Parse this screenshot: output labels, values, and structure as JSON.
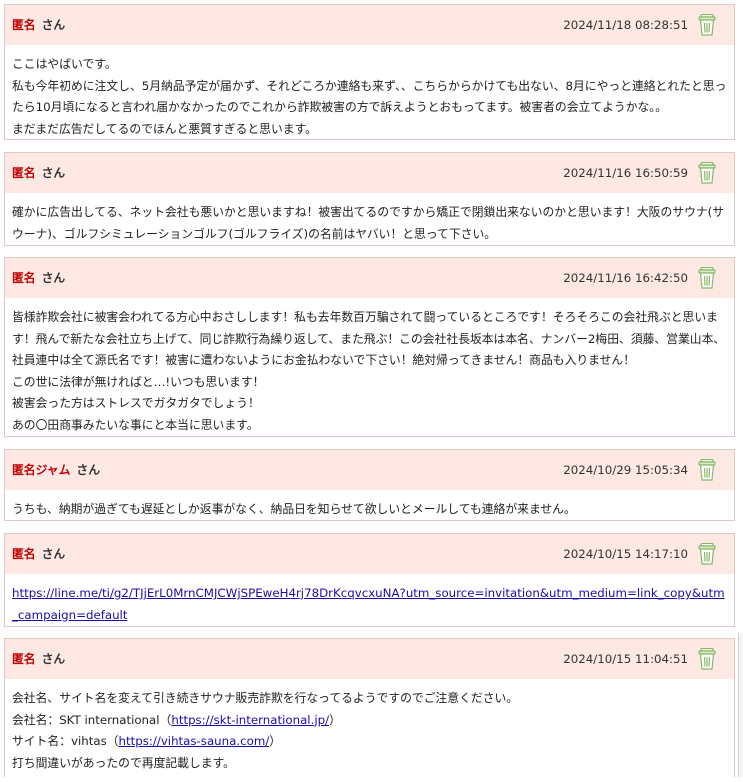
{
  "comments": [
    {
      "author": "匿名",
      "suffix": "さん",
      "date": "2024/11/18 08:28:51",
      "lines": [
        "ここはやばいです。",
        "私も今年初めに注文し、5月納品予定が届かず、それどころか連絡も来ず、、こちらからかけても出ない、8月にやっと連絡とれたと思ったら10月頃になると言われ届かなかったのでこれから詐欺被害の方で訴えようとおもってます。被害者の会立てようかな。。",
        "まだまだ広告だしてるのでほんと悪質すぎると思います。"
      ]
    },
    {
      "author": "匿名",
      "suffix": "さん",
      "date": "2024/11/16 16:50:59",
      "lines": [
        "確かに広告出してる、ネット会社も悪いかと思いますね！被害出てるのですから矯正で閉鎖出来ないのかと思います！大阪のサウナ(サウーナ)、ゴルフシミュレーションゴルフ(ゴルフライズ)の名前はヤバい！と思って下さい。"
      ]
    },
    {
      "author": "匿名",
      "suffix": "さん",
      "date": "2024/11/16 16:42:50",
      "lines": [
        "皆様詐欺会社に被害会われてる方心中おさしします！私も去年数百万騙されて闘っているところです！そろそろこの会社飛ぶと思います！飛んで新たな会社立ち上げて、同じ詐欺行為繰り返して、また飛ぶ！この会社社長坂本は本名、ナンバー2梅田、須藤、営業山本、社員連中は全て源氏名です！被害に遭わないようにお金払わないで下さい！絶対帰ってきません！商品も入りません！",
        "この世に法律が無ければと…!いつも思います！",
        "被害会った方はストレスでガタガタでしょう！",
        "あの〇田商事みたいな事にと本当に思います。"
      ]
    },
    {
      "author": "匿名ジャム",
      "suffix": "さん",
      "date": "2024/10/29 15:05:34",
      "lines": [
        "うちも、納期が過ぎても遅延としか返事がなく、納品日を知らせて欲しいとメールしても連絡が来ません。"
      ]
    },
    {
      "author": "匿名",
      "suffix": "さん",
      "date": "2024/10/15 14:17:10",
      "link": "https://line.me/ti/g2/TJjErL0MrnCMJCWjSPEweH4rj78DrKcqvcxuNA?utm_source=invitation&utm_medium=link_copy&utm_campaign=default"
    },
    {
      "author": "匿名",
      "suffix": "さん",
      "date": "2024/10/15 11:04:51",
      "intro": "会社名、サイト名を変えて引き続きサウナ販売詐欺を行なってるようですのでご注意ください。",
      "company_label": "会社名：SKT international（",
      "company_url": "https://skt-international.jp/",
      "company_close": "）",
      "site_label": "サイト名：vihtas（",
      "site_url": "https://vihtas-sauna.com/",
      "site_close": "）",
      "outro": "打ち間違いがあったので再度記載します。"
    }
  ],
  "icons": {
    "delete": "trash-can-icon"
  },
  "colors": {
    "header_bg": "#fde8e3",
    "author": "#c00000",
    "link": "#1a0dab",
    "trash": "#8ab66a"
  }
}
